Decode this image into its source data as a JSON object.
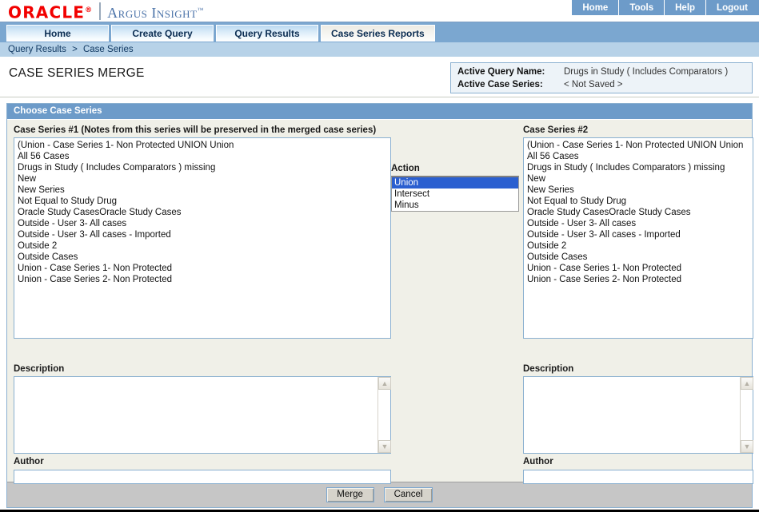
{
  "brand": {
    "oracle": "ORACLE",
    "oracle_mark": "®",
    "product": "Argus Insight",
    "product_mark": "™"
  },
  "topnav": [
    {
      "label": "Home",
      "name": "topnav-home"
    },
    {
      "label": "Tools",
      "name": "topnav-tools"
    },
    {
      "label": "Help",
      "name": "topnav-help"
    },
    {
      "label": "Logout",
      "name": "topnav-logout"
    }
  ],
  "tabs": [
    {
      "label": "Home",
      "active": false
    },
    {
      "label": "Create Query",
      "active": false
    },
    {
      "label": "Query Results",
      "active": false
    },
    {
      "label": "Case Series Reports",
      "active": true
    }
  ],
  "breadcrumb": {
    "first": "Query Results",
    "separator": ">",
    "second": "Case Series"
  },
  "page": {
    "title": "CASE SERIES MERGE"
  },
  "active_info": {
    "query_label": "Active Query Name:",
    "query_value": "Drugs in Study ( Includes Comparators )",
    "series_label": "Active Case Series:",
    "series_value": "< Not Saved >"
  },
  "panel": {
    "header": "Choose Case Series"
  },
  "series1": {
    "label": "Case Series #1 (Notes from this series will be preserved in the merged case series)",
    "options": [
      "(Union - Case Series 1- Non Protected UNION Union",
      "All 56 Cases",
      "Drugs in Study ( Includes Comparators ) missing",
      "New",
      "New Series",
      "Not Equal to Study Drug",
      "Oracle Study CasesOracle Study Cases",
      "Outside - User 3- All cases",
      "Outside - User 3- All cases - Imported",
      "Outside 2",
      "Outside Cases",
      "Union - Case Series 1- Non Protected",
      "Union - Case Series 2- Non Protected"
    ],
    "description_label": "Description",
    "description_value": "",
    "author_label": "Author",
    "author_value": ""
  },
  "action": {
    "label": "Action",
    "options": [
      "Union",
      "Intersect",
      "Minus"
    ],
    "selected": "Union"
  },
  "series2": {
    "label": "Case Series #2",
    "options": [
      "(Union - Case Series 1- Non Protected UNION Union",
      "All 56 Cases",
      "Drugs in Study ( Includes Comparators ) missing",
      "New",
      "New Series",
      "Not Equal to Study Drug",
      "Oracle Study CasesOracle Study Cases",
      "Outside - User 3- All cases",
      "Outside - User 3- All cases - Imported",
      "Outside 2",
      "Outside Cases",
      "Union - Case Series 1- Non Protected",
      "Union - Case Series 2- Non Protected"
    ],
    "description_label": "Description",
    "description_value": "",
    "author_label": "Author",
    "author_value": ""
  },
  "footer": {
    "merge_label": "Merge",
    "cancel_label": "Cancel"
  },
  "icons": {
    "scroll_up": "▲",
    "scroll_down": "▼"
  },
  "colors": {
    "brand_red": "#f20000",
    "brand_blue": "#4a72a8",
    "nav_blue": "#6d9bc9",
    "tabbar_blue": "#7ba7d0",
    "breadcrumb_blue": "#b7d2e8",
    "panel_bg": "#f0f0e8",
    "select_blue": "#2a5fd0",
    "footer_gray": "#c6c6c6"
  }
}
